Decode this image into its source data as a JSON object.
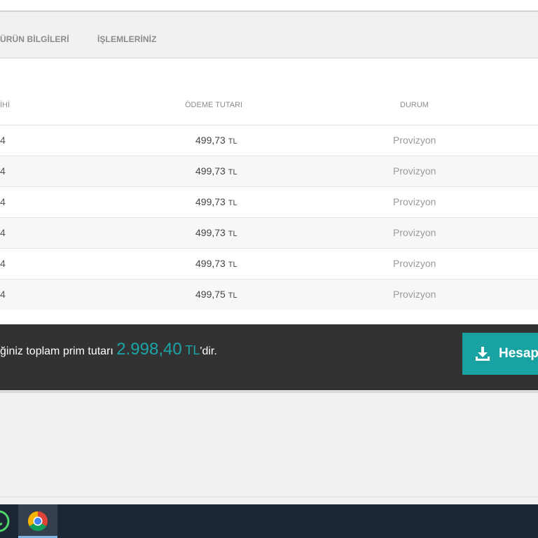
{
  "tabs": [
    {
      "label": "ÜRÜN BİLGİLERİ"
    },
    {
      "label": "İŞLEMLERİNİZ"
    }
  ],
  "table": {
    "headers": [
      "İHİ",
      "ÖDEME TUTARI",
      "DURUM"
    ],
    "rows": [
      {
        "date": "4",
        "amount": "499,73",
        "currency": "TL",
        "status": "Provizyon"
      },
      {
        "date": "4",
        "amount": "499,73",
        "currency": "TL",
        "status": "Provizyon"
      },
      {
        "date": "4",
        "amount": "499,73",
        "currency": "TL",
        "status": "Provizyon"
      },
      {
        "date": "4",
        "amount": "499,73",
        "currency": "TL",
        "status": "Provizyon"
      },
      {
        "date": "4",
        "amount": "499,73",
        "currency": "TL",
        "status": "Provizyon"
      },
      {
        "date": "4",
        "amount": "499,75",
        "currency": "TL",
        "status": "Provizyon"
      }
    ]
  },
  "summary": {
    "prefix": "ğiniz toplam prim tutarı ",
    "amount": "2.998,40",
    "currency": " TL",
    "suffix": "'dir."
  },
  "download_button": {
    "label": "Hesap",
    "icon": "download-icon"
  },
  "taskbar": {
    "apps": [
      "whatsapp-icon",
      "chrome-icon"
    ]
  },
  "colors": {
    "accent": "#1ba5a9",
    "button": "#18a2a1",
    "summary_bg": "#323232",
    "taskbar_bg": "#1c2632"
  }
}
